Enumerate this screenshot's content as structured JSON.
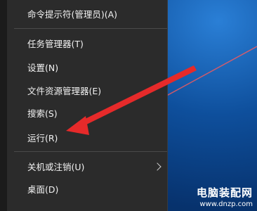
{
  "context_menu": {
    "items": [
      {
        "label": "命令提示符(管理员)(A)"
      },
      {
        "label": "任务管理器(T)"
      },
      {
        "label": "设置(N)"
      },
      {
        "label": "文件资源管理器(E)"
      },
      {
        "label": "搜索(S)"
      },
      {
        "label": "运行(R)"
      },
      {
        "label": "关机或注销(U)"
      },
      {
        "label": "桌面(D)"
      }
    ]
  },
  "watermark": {
    "main": "电脑装配网",
    "url": "www.dnzp.com"
  },
  "colors": {
    "menu_bg": "#2b2b2b",
    "menu_text": "#f2f2f2",
    "annotation_arrow": "#e62a2a",
    "desktop_bg": "#0e4f9c"
  }
}
